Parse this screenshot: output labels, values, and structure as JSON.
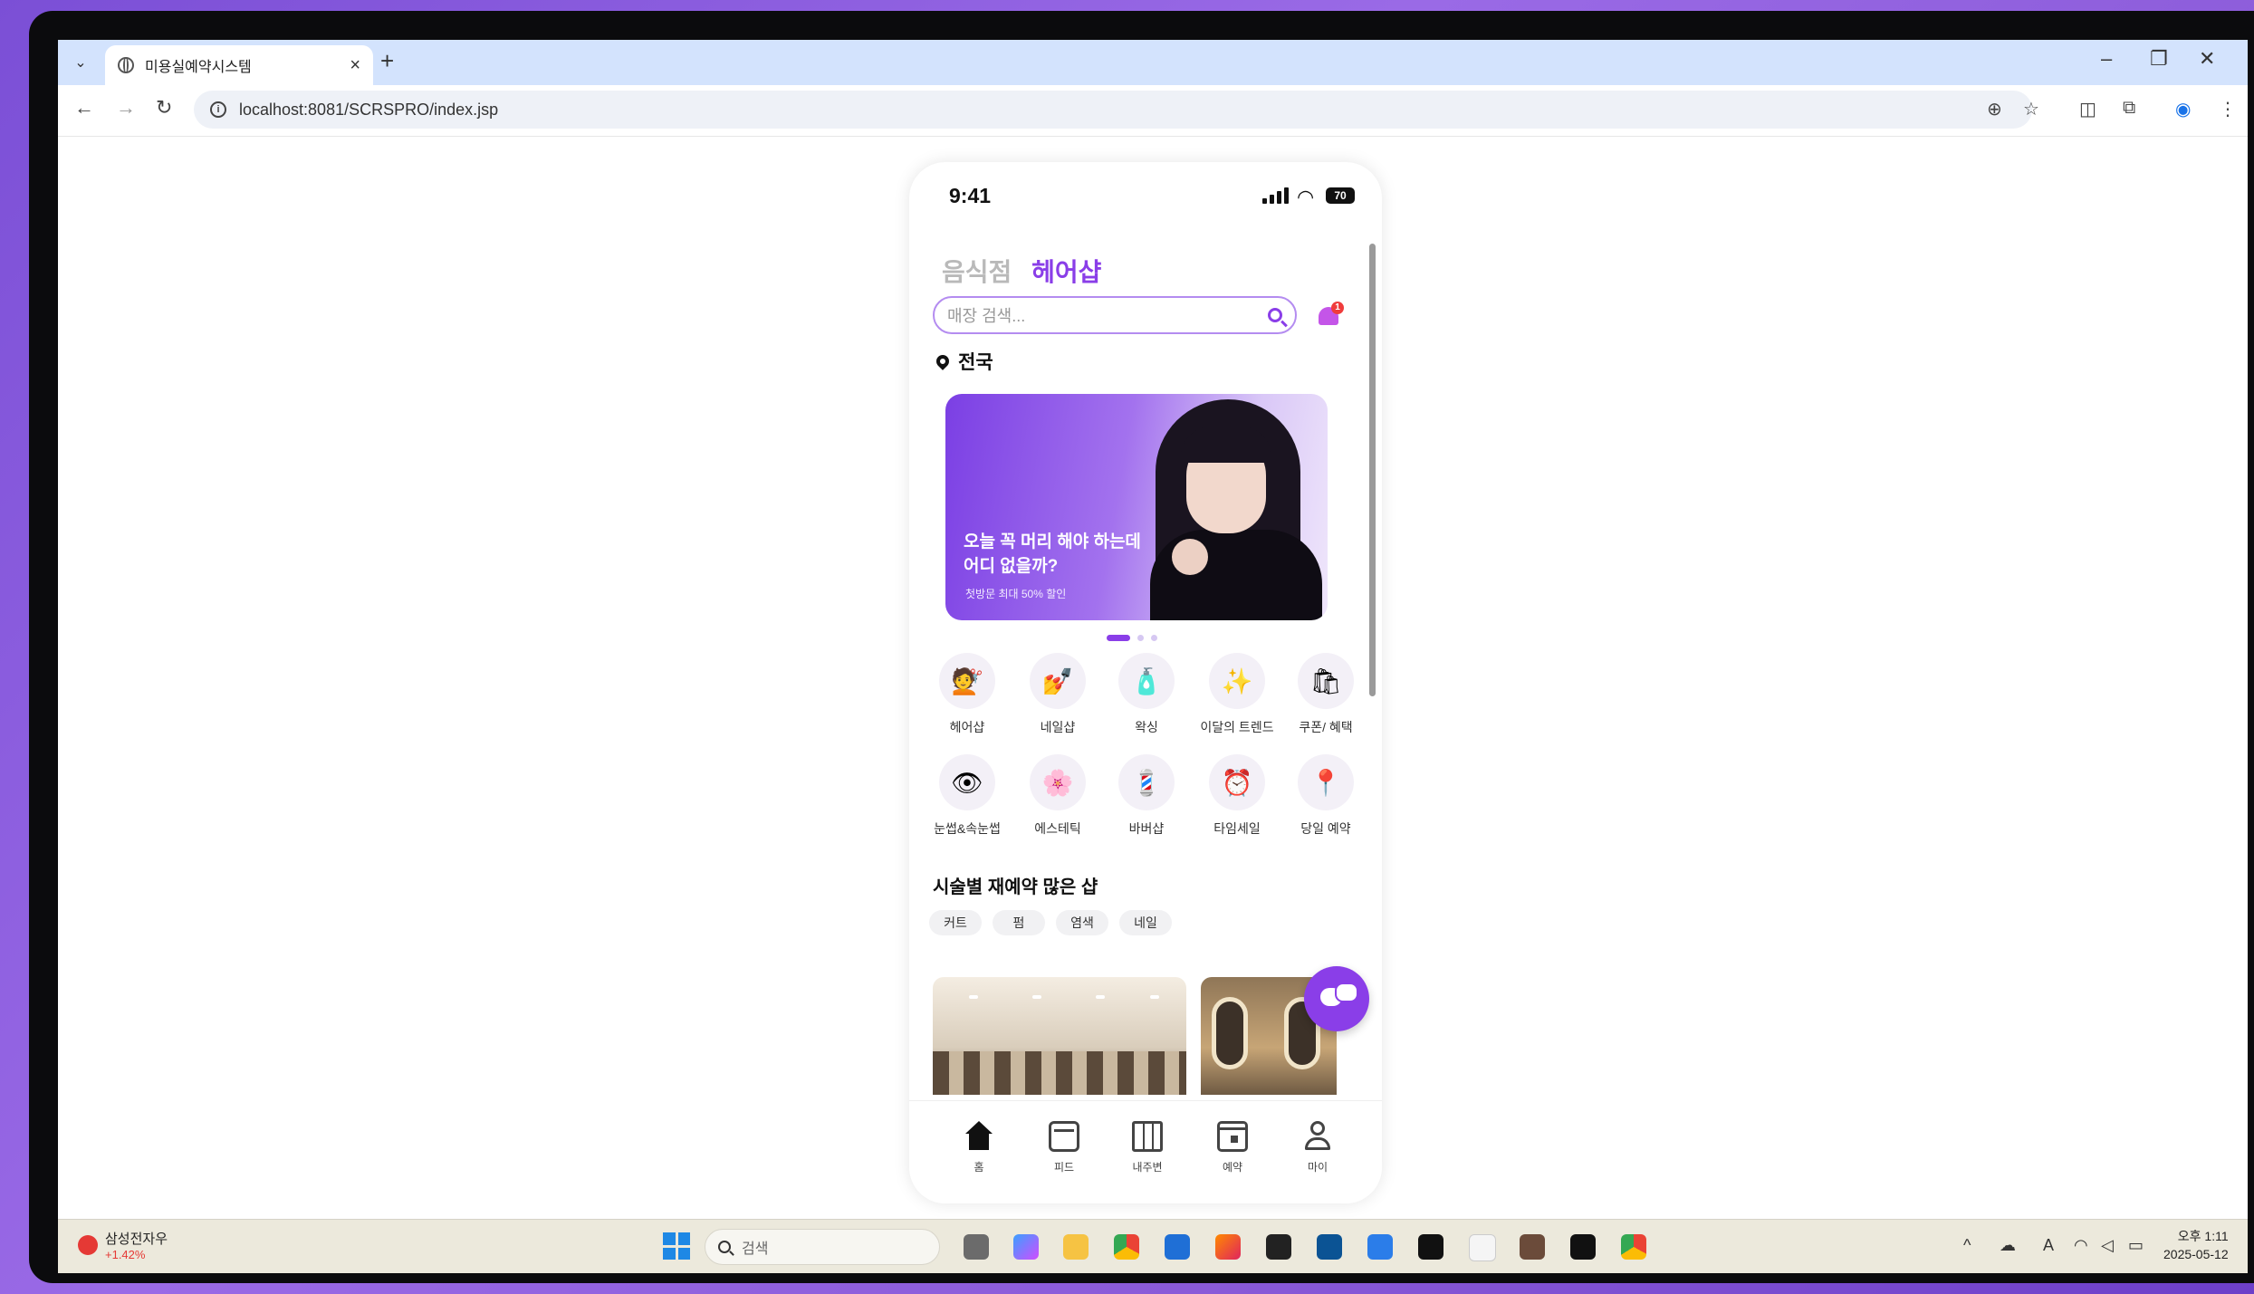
{
  "browser": {
    "tab_title": "미용실예약시스템",
    "tab_close": "×",
    "new_tab": "+",
    "url": "localhost:8081/SCRSPRO/index.jsp",
    "window_controls": [
      "–",
      "❐",
      "✕"
    ]
  },
  "phone": {
    "status_time": "9:41",
    "battery": "70",
    "categories": [
      "음식점",
      "헤어샵"
    ],
    "search_placeholder": "매장 검색...",
    "notification_count": "1",
    "location": "전국",
    "banner": {
      "headline_line1": "오늘 꼭 머리 해야 하는데",
      "headline_line2": "어디 없을까?",
      "subtext": "첫방문 최대 50% 할인"
    },
    "menu": [
      {
        "label": "헤어샵",
        "icon": "💇"
      },
      {
        "label": "네일샵",
        "icon": "💅"
      },
      {
        "label": "왁싱",
        "icon": "🧴"
      },
      {
        "label": "이달의 트렌드",
        "icon": "✨"
      },
      {
        "label": "쿠폰/ 혜택",
        "icon": "🛍"
      },
      {
        "label": "눈썹&속눈썹",
        "icon": "👁"
      },
      {
        "label": "에스테틱",
        "icon": "🌸"
      },
      {
        "label": "바버샵",
        "icon": "💈"
      },
      {
        "label": "타임세일",
        "icon": "⏰"
      },
      {
        "label": "당일 예약",
        "icon": "📍"
      }
    ],
    "section_title": "시술별 재예약 많은 샵",
    "chips": [
      "커트",
      "펌",
      "염색",
      "네일"
    ],
    "bottom_nav": [
      "홈",
      "피드",
      "내주변",
      "예약",
      "마이"
    ]
  },
  "taskbar": {
    "stock_name": "삼성전자우",
    "stock_change": "+1.42%",
    "search_placeholder": "검색",
    "time": "오후 1:11",
    "date": "2025-05-12"
  },
  "colors": {
    "accent": "#8a3ee8",
    "chrome_tabstrip": "#d3e3fd",
    "taskbar": "#ece9dc"
  }
}
